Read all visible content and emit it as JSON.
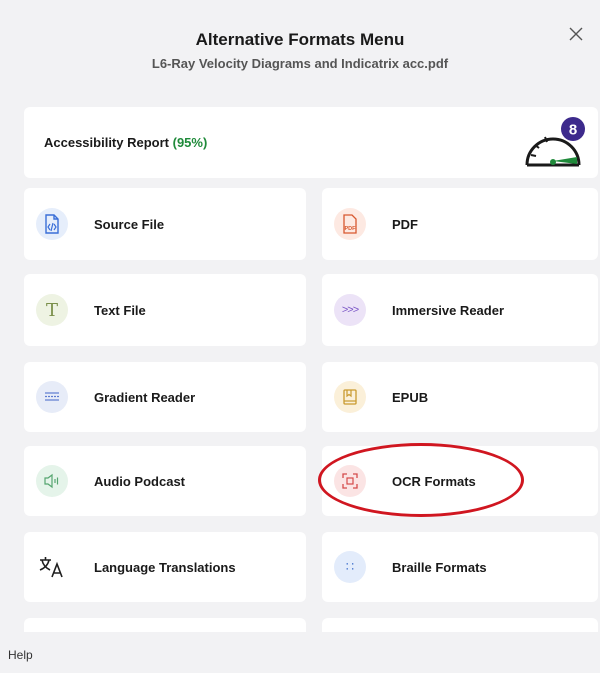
{
  "header": {
    "title": "Alternative Formats Menu",
    "subtitle": "L6-Ray Velocity Diagrams and Indicatrix acc.pdf",
    "close_glyph": "×"
  },
  "report": {
    "label": "Accessibility Report",
    "percent": "(95%)",
    "badge": "8",
    "score_fraction": 0.95
  },
  "formats": {
    "source_file": "Source File",
    "pdf": "PDF",
    "pdf_icon_text": "PDF",
    "text_file": "Text File",
    "text_icon_glyph": "T",
    "immersive_reader": "Immersive Reader",
    "immersive_icon_glyph": ">>>",
    "gradient_reader": "Gradient Reader",
    "epub": "EPUB",
    "audio_podcast": "Audio Podcast",
    "ocr_formats": "OCR Formats",
    "language_translations": "Language Translations",
    "braille_formats": "Braille Formats",
    "braille_icon_glyph": "∷"
  },
  "footer": {
    "help": "Help"
  },
  "colors": {
    "accessibility_green": "#1f8a3a",
    "annotation_red": "#d01620",
    "badge_purple": "#3d2a8c"
  }
}
